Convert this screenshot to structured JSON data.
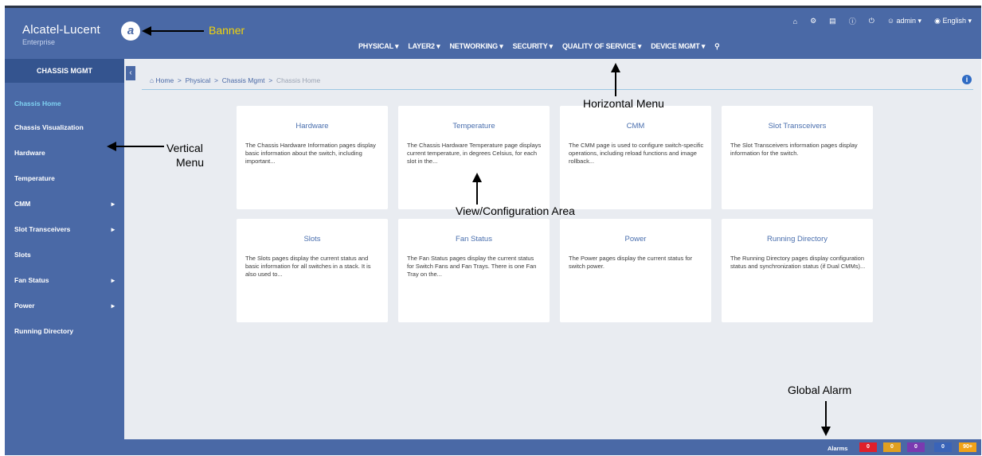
{
  "banner": {
    "brand": "Alcatel-Lucent",
    "brand_sub": "Enterprise",
    "brand_mark": "a",
    "icons": [
      "home-icon",
      "gear-icon",
      "clipboard-icon",
      "help-icon",
      "power-icon"
    ],
    "user": "admin",
    "language": "English"
  },
  "horizontal_menu": {
    "items": [
      "PHYSICAL",
      "LAYER2",
      "NETWORKING",
      "SECURITY",
      "QUALITY OF SERVICE",
      "DEVICE MGMT"
    ]
  },
  "sidebar": {
    "header": "CHASSIS MGMT",
    "items": [
      {
        "label": "Chassis Home",
        "active": true,
        "submenu": false
      },
      {
        "label": "Chassis Visualization",
        "active": false,
        "submenu": false
      },
      {
        "label": "Hardware",
        "active": false,
        "submenu": false
      },
      {
        "label": "Temperature",
        "active": false,
        "submenu": false
      },
      {
        "label": "CMM",
        "active": false,
        "submenu": true
      },
      {
        "label": "Slot Transceivers",
        "active": false,
        "submenu": true
      },
      {
        "label": "Slots",
        "active": false,
        "submenu": false
      },
      {
        "label": "Fan Status",
        "active": false,
        "submenu": true
      },
      {
        "label": "Power",
        "active": false,
        "submenu": true
      },
      {
        "label": "Running Directory",
        "active": false,
        "submenu": false
      }
    ]
  },
  "breadcrumb": {
    "items": [
      "Home",
      "Physical",
      "Chassis Mgmt"
    ],
    "current": "Chassis Home"
  },
  "cards": [
    {
      "title": "Hardware",
      "desc": "The Chassis Hardware Information pages display basic information about the switch, including important..."
    },
    {
      "title": "Temperature",
      "desc": "The Chassis Hardware Temperature page displays current temperature, in degrees Celsius, for each slot in the..."
    },
    {
      "title": "CMM",
      "desc": "The CMM page is used to configure switch-specific operations, including reload functions and image rollback..."
    },
    {
      "title": "Slot Transceivers",
      "desc": "The Slot Transceivers information pages display information for the switch."
    },
    {
      "title": "Slots",
      "desc": "The Slots pages display the current status and basic information for all switches in a stack. It is also used to..."
    },
    {
      "title": "Fan Status",
      "desc": "The Fan Status pages display the current status for Switch Fans and Fan Trays. There is one Fan Tray on the..."
    },
    {
      "title": "Power",
      "desc": "The Power pages display the current status for switch power."
    },
    {
      "title": "Running Directory",
      "desc": "The Running Directory pages display configuration status and synchronization status (if Dual CMMs)..."
    }
  ],
  "annotations": {
    "banner": "Banner",
    "horizontal_menu": "Horizontal Menu",
    "vertical_menu_line1": "Vertical",
    "vertical_menu_line2": "Menu",
    "view_area": "View/Configuration Area",
    "global_alarm": "Global Alarm"
  },
  "alarms": {
    "label": "Alarms",
    "badges": [
      {
        "value": "0",
        "color": "#e0202a"
      },
      {
        "value": "0",
        "color": "#e0a020"
      },
      {
        "value": "0",
        "color": "#7a3ab0"
      },
      {
        "value": "0",
        "color": "#3a64b8"
      },
      {
        "value": "90+",
        "color": "#f0a218"
      }
    ]
  },
  "colors": {
    "brand_blue": "#4a69a6",
    "active_item": "#7fd2f2",
    "annotation_banner": "#f2d40a"
  }
}
